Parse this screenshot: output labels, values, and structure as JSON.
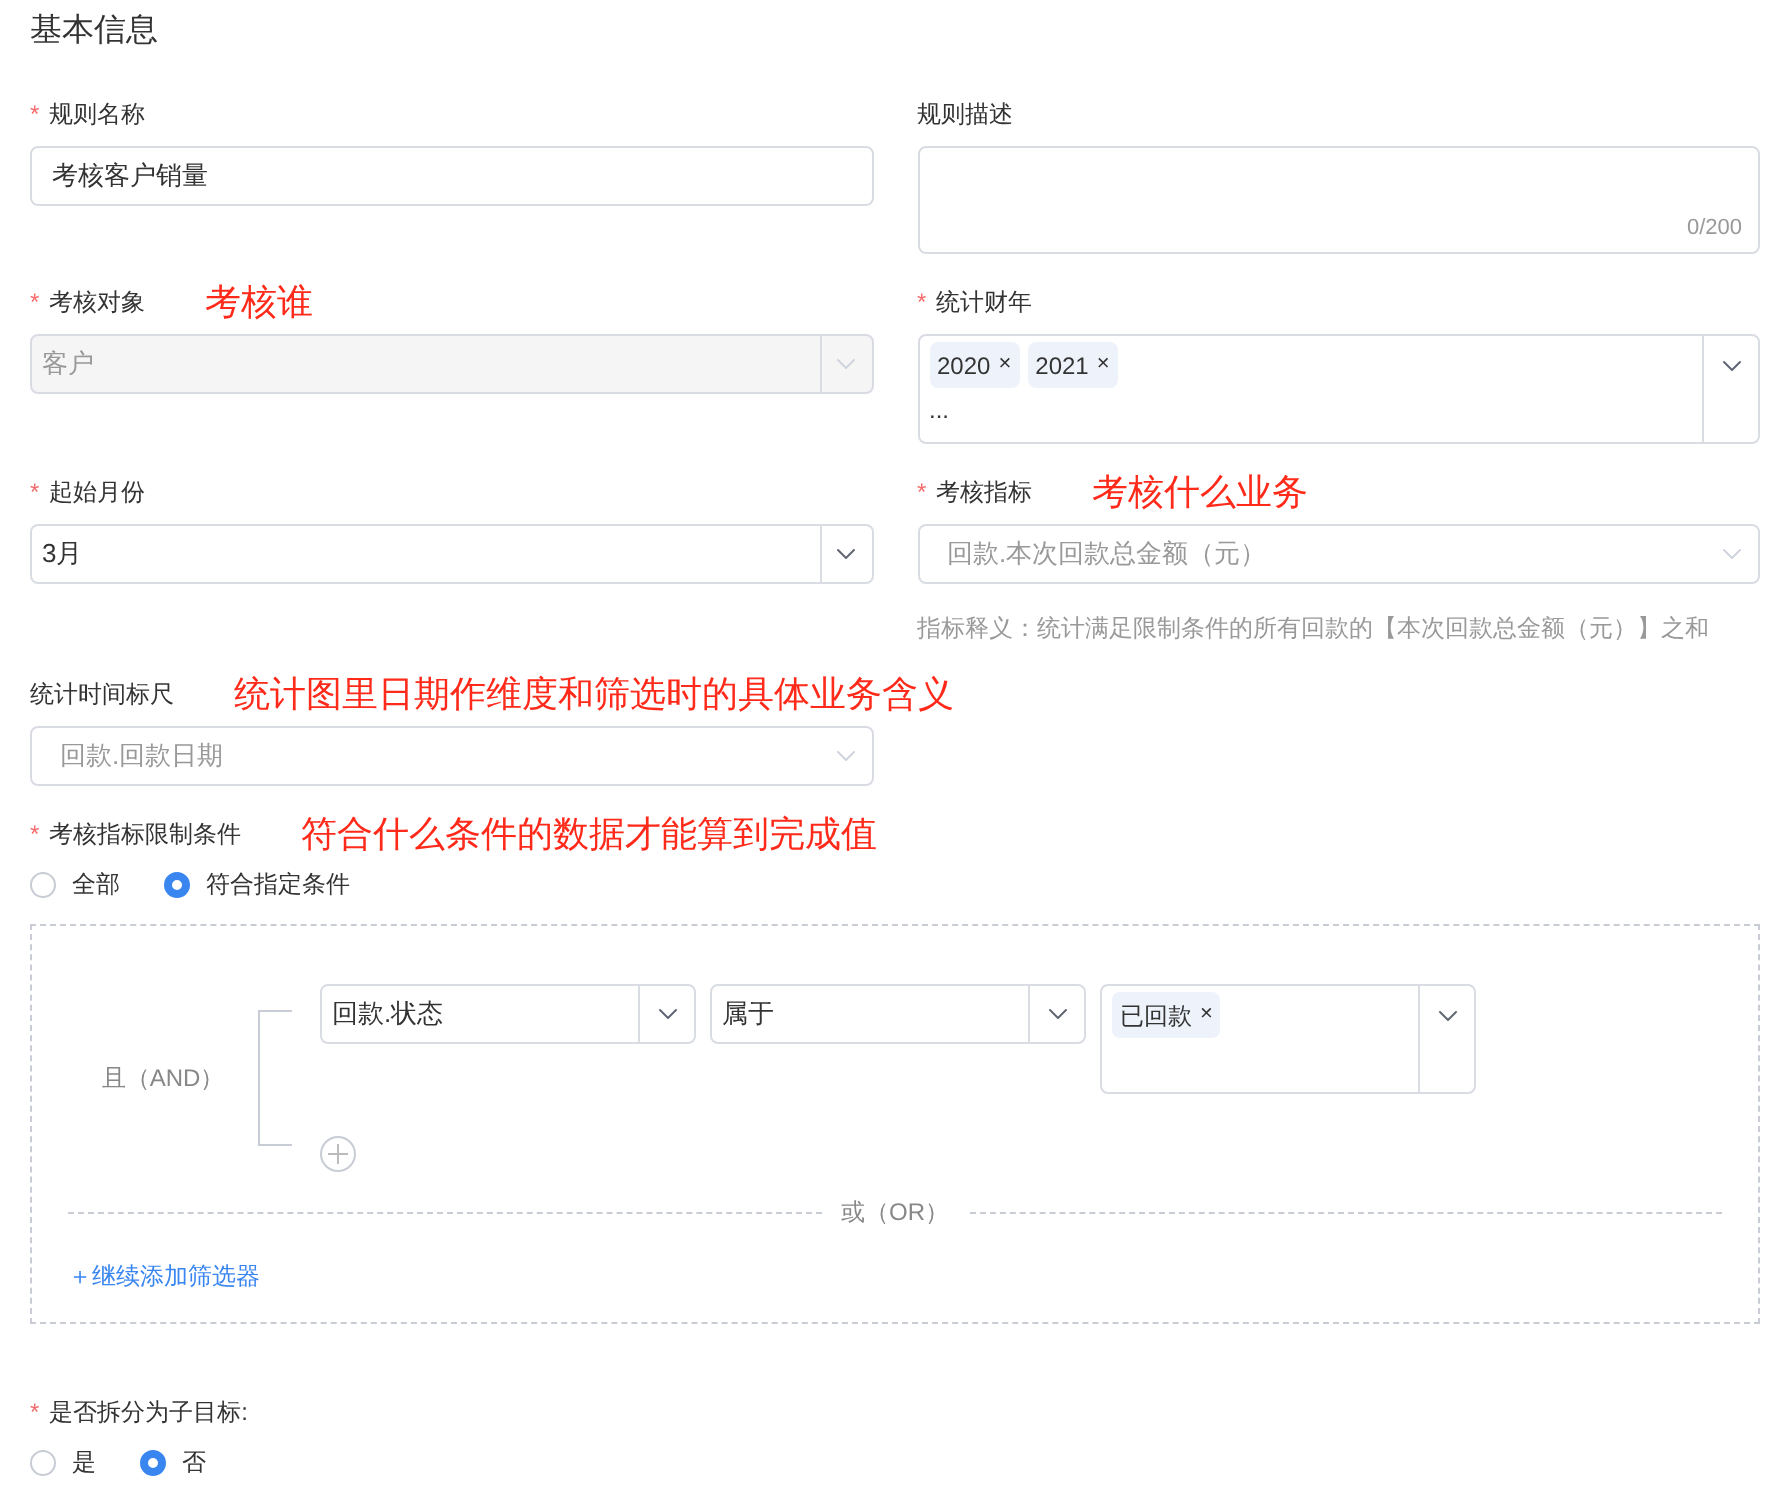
{
  "section_title": "基本信息",
  "form_rows": [
    [
      {
        "kind": "input",
        "label": "规则名称",
        "required_mark": "*",
        "value": "考核客户销量"
      },
      {
        "kind": "textarea",
        "label": "规则描述",
        "counter": "0/200"
      }
    ],
    [
      {
        "kind": "select",
        "label": "考核对象",
        "required_mark": "*",
        "annotation": "考核谁",
        "value": "客户",
        "disabled": true,
        "readonly": false
      },
      {
        "kind": "multiselect",
        "label": "统计财年",
        "required_mark": "*",
        "tags": [
          {
            "label": "2020",
            "remove": "×"
          },
          {
            "label": "2021",
            "remove": "×"
          }
        ],
        "overflow": "..."
      }
    ],
    [
      {
        "kind": "select",
        "label": "起始月份",
        "required_mark": "*",
        "value": "3月",
        "disabled": false,
        "readonly": false
      },
      {
        "kind": "select",
        "label": "考核指标",
        "required_mark": "*",
        "annotation": "考核什么业务",
        "value": "回款.本次回款总金额（元）",
        "hint": "指标释义：统计满足限制条件的所有回款的【本次回款总金额（元）】之和",
        "disabled": false,
        "readonly": true
      }
    ],
    [
      {
        "kind": "select",
        "label": "统计时间标尺",
        "annotation": "统计图里日期作维度和筛选时的具体业务含义",
        "value": "回款.回款日期",
        "disabled": false,
        "readonly": true
      }
    ]
  ],
  "condition_section": {
    "label": "考核指标限制条件",
    "required_mark": "*",
    "annotation": "符合什么条件的数据才能算到完成值",
    "options": [
      {
        "label": "全部",
        "selected": false
      },
      {
        "label": "符合指定条件",
        "selected": true
      }
    ],
    "filter_box": {
      "and_label": "且（AND）",
      "conditions": [
        {
          "field": "回款.状态",
          "operator": "属于",
          "tags": [
            {
              "label": "已回款",
              "remove": "×"
            }
          ]
        }
      ],
      "or_label": "或（OR）",
      "add_link": "＋继续添加筛选器"
    }
  },
  "split_section": {
    "label": "是否拆分为子目标:",
    "required_mark": "*",
    "options": [
      {
        "label": "是",
        "selected": false
      },
      {
        "label": "否",
        "selected": true
      }
    ]
  }
}
